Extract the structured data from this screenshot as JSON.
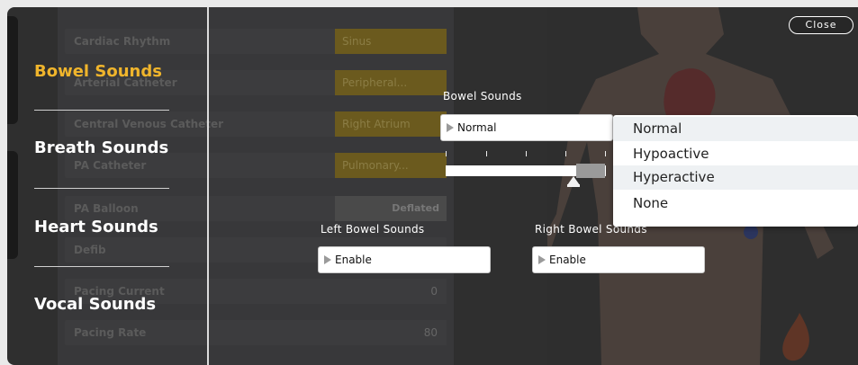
{
  "background_rows": [
    {
      "label": "Cardiac Rhythm",
      "value": "Sinus"
    },
    {
      "label": "Arterial Catheter",
      "value": "Peripheral..."
    },
    {
      "label": "Central Venous Catheter",
      "value": "Right Atrium"
    },
    {
      "label": "PA Catheter",
      "value": "Pulmonary..."
    },
    {
      "label": "PA Balloon",
      "value": "Deflated"
    },
    {
      "label": "Defib",
      "value": ""
    },
    {
      "label": "Pacing Current",
      "value": "0"
    },
    {
      "label": "Pacing Rate",
      "value": "80"
    }
  ],
  "categories": [
    {
      "label": "Bowel Sounds",
      "active": true
    },
    {
      "label": "Breath Sounds",
      "active": false
    },
    {
      "label": "Heart Sounds",
      "active": false
    },
    {
      "label": "Vocal Sounds",
      "active": false
    }
  ],
  "bowel": {
    "label": "Bowel Sounds",
    "selected": "Normal",
    "volume_level": 0.8,
    "options": [
      "Normal",
      "Hypoactive",
      "Hyperactive",
      "None"
    ]
  },
  "left_bowel": {
    "label": "Left Bowel Sounds",
    "value": "Enable"
  },
  "right_bowel": {
    "label": "Right Bowel Sounds",
    "value": "Enable"
  },
  "close_label": "Close",
  "colors": {
    "accent": "#f0b52c",
    "panel": "#2f2f2f"
  }
}
